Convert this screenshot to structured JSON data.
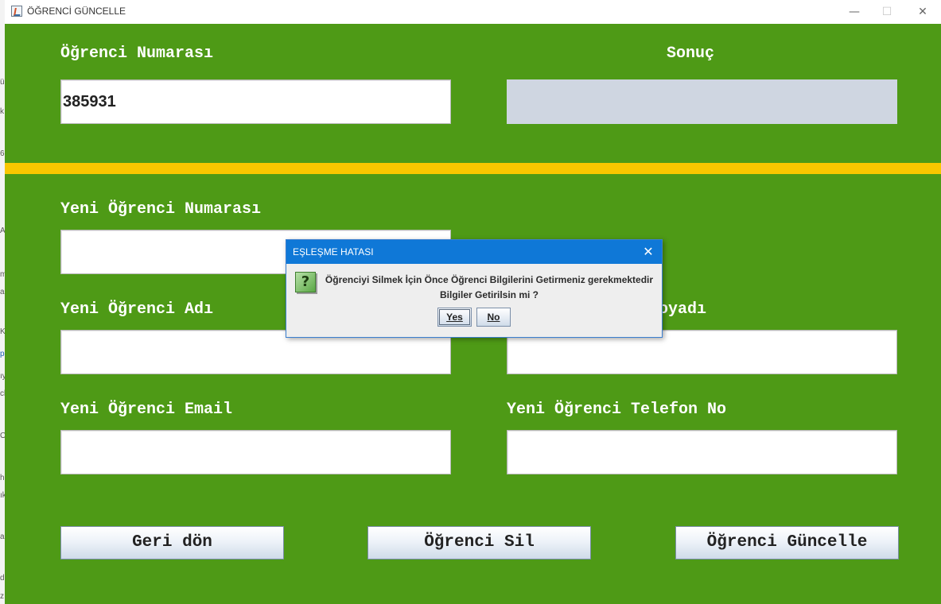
{
  "window": {
    "title": "ÖĞRENCİ GÜNCELLE",
    "controls": {
      "minimize": "—",
      "maximize": "☐",
      "close": "✕"
    }
  },
  "background_fragments": [
    "ü",
    "k",
    "6",
    "A",
    "m",
    "ar",
    "K",
    "p",
    "ıy",
    "cl",
    "O",
    "he",
    "ık",
    "a",
    "d",
    "z"
  ],
  "form": {
    "student_number_label": "Öğrenci Numarası",
    "student_number_value": "385931",
    "result_label": "Sonuç",
    "result_value": "",
    "new_number_label": "Yeni Öğrenci Numarası",
    "new_number_value": "",
    "new_name_label": "Yeni Öğrenci Adı",
    "new_name_value": "",
    "new_surname_label_visible": "oyadı",
    "new_surname_value": "",
    "new_email_label": "Yeni Öğrenci Email",
    "new_email_value": "",
    "new_phone_label": "Yeni Öğrenci Telefon No",
    "new_phone_value": ""
  },
  "buttons": {
    "back": "Geri dön",
    "delete": "Öğrenci Sil",
    "update": "Öğrenci Güncelle"
  },
  "dialog": {
    "title": "EŞLEŞME HATASI",
    "icon": "question-icon",
    "icon_glyph": "?",
    "close_glyph": "✕",
    "message_line1": "Öğrenciyi Silmek İçin Önce Öğrenci Bilgilerini Getirmeniz gerekmektedir",
    "message_line2": "Bilgiler Getirilsin mi ?",
    "yes_label": "Yes",
    "no_label": "No"
  },
  "colors": {
    "panel_green": "#4e9a16",
    "divider_yellow": "#f9c700",
    "dialog_title_blue": "#0f78d7",
    "readonly_field": "#cfd6e1"
  }
}
